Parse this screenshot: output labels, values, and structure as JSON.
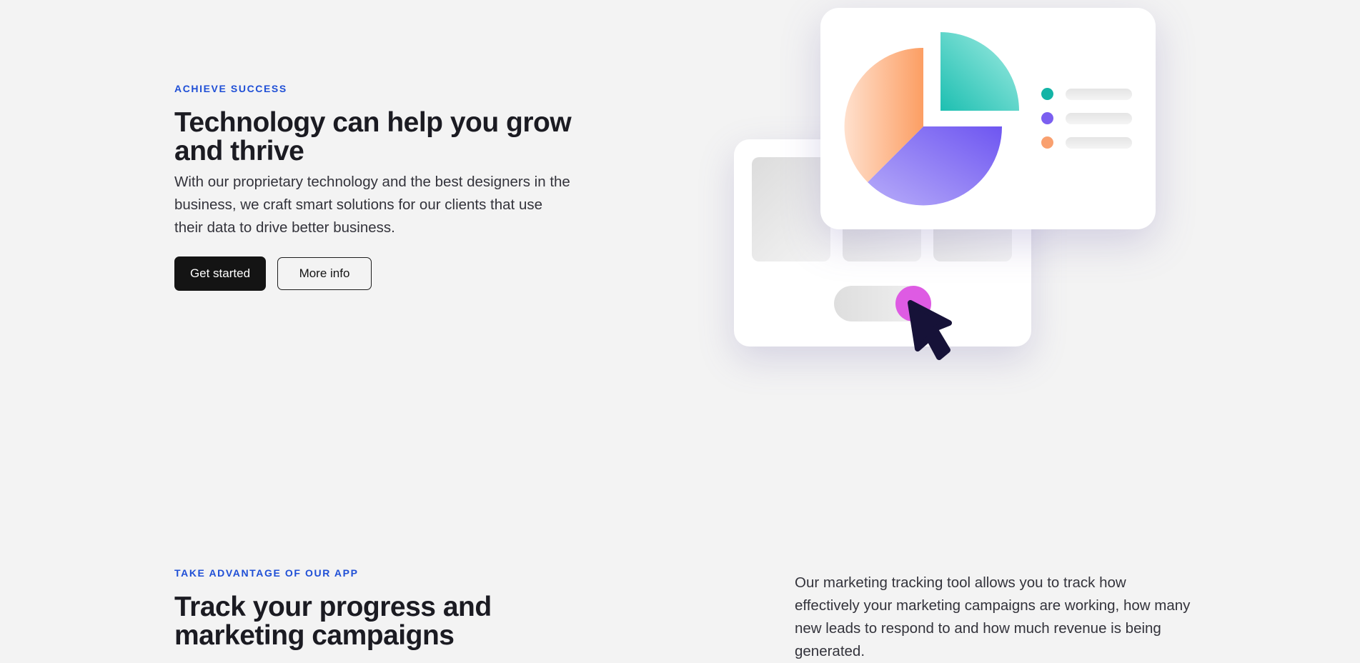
{
  "hero": {
    "eyebrow": "ACHIEVE SUCCESS",
    "title": "Technology can help you grow and thrive",
    "body": "With our proprietary technology and the best designers in the business, we craft smart solutions for our clients that use their data to drive better business.",
    "primary_button": "Get started",
    "secondary_button": "More info"
  },
  "illustration": {
    "pie_colors": {
      "teal": "#2cc4b8",
      "violet": "#7b67f3",
      "peach": "#fca872"
    },
    "legend_colors": [
      "#13b4a6",
      "#7b5ff0",
      "#f9a06f"
    ],
    "toggle_knob_color": "#de5be3",
    "cursor_icon": "pointer-arrow-icon"
  },
  "section2": {
    "eyebrow": "TAKE ADVANTAGE OF OUR APP",
    "title": "Track your progress and marketing campaigns",
    "body": "Our marketing tracking tool allows you to track how effectively your marketing campaigns are working, how many new leads to respond to and how much revenue is being generated."
  },
  "colors": {
    "accent": "#1f4fd6",
    "background": "#f3f3f3",
    "text": "#1b1b22"
  }
}
